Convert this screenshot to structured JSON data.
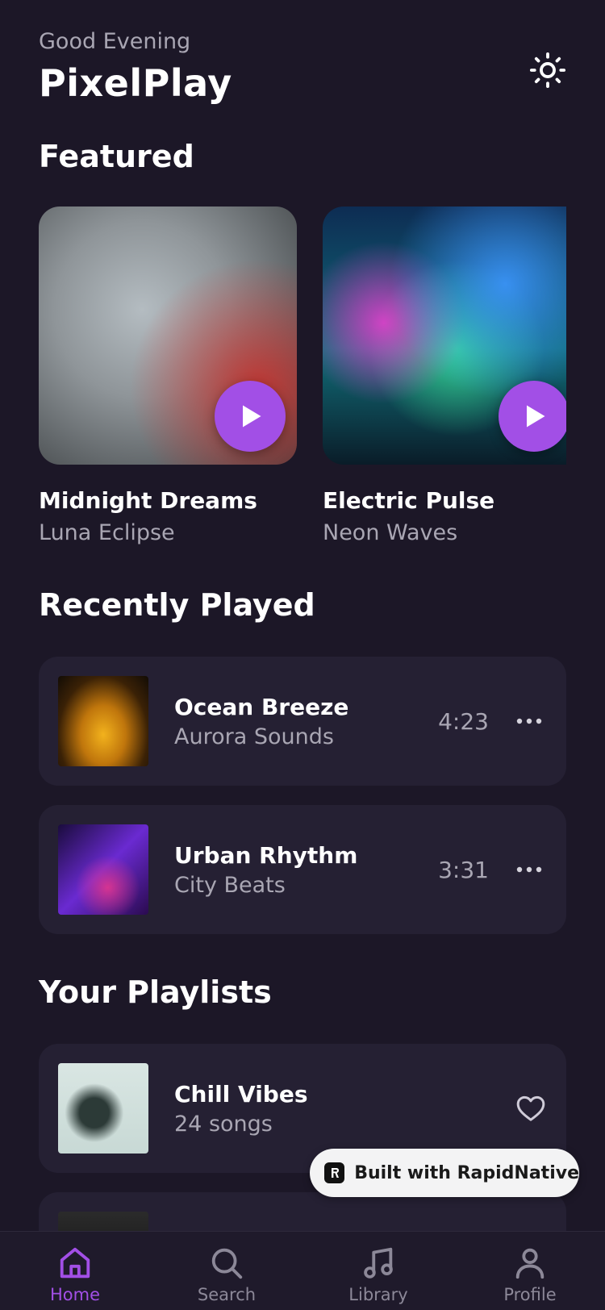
{
  "header": {
    "greeting": "Good Evening",
    "title": "PixelPlay",
    "theme_toggle_icon": "sun-icon"
  },
  "featured": {
    "section_title": "Featured",
    "items": [
      {
        "title": "Midnight Dreams",
        "artist": "Luna Eclipse"
      },
      {
        "title": "Electric Pulse",
        "artist": "Neon Waves"
      }
    ]
  },
  "recently_played": {
    "section_title": "Recently Played",
    "items": [
      {
        "title": "Ocean Breeze",
        "artist": "Aurora Sounds",
        "duration": "4:23"
      },
      {
        "title": "Urban Rhythm",
        "artist": "City Beats",
        "duration": "3:31"
      }
    ]
  },
  "playlists": {
    "section_title": "Your Playlists",
    "items": [
      {
        "title": "Chill Vibes",
        "subtitle": "24 songs"
      }
    ]
  },
  "badge": {
    "label": "Built with RapidNative"
  },
  "bottom_nav": {
    "items": [
      {
        "label": "Home",
        "icon": "home-icon",
        "active": true
      },
      {
        "label": "Search",
        "icon": "search-icon",
        "active": false
      },
      {
        "label": "Library",
        "icon": "music-note-icon",
        "active": false
      },
      {
        "label": "Profile",
        "icon": "user-icon",
        "active": false
      }
    ]
  },
  "colors": {
    "background": "#1c1727",
    "card": "#252033",
    "accent": "#a24fe6",
    "muted_text": "#a9a6b3"
  }
}
